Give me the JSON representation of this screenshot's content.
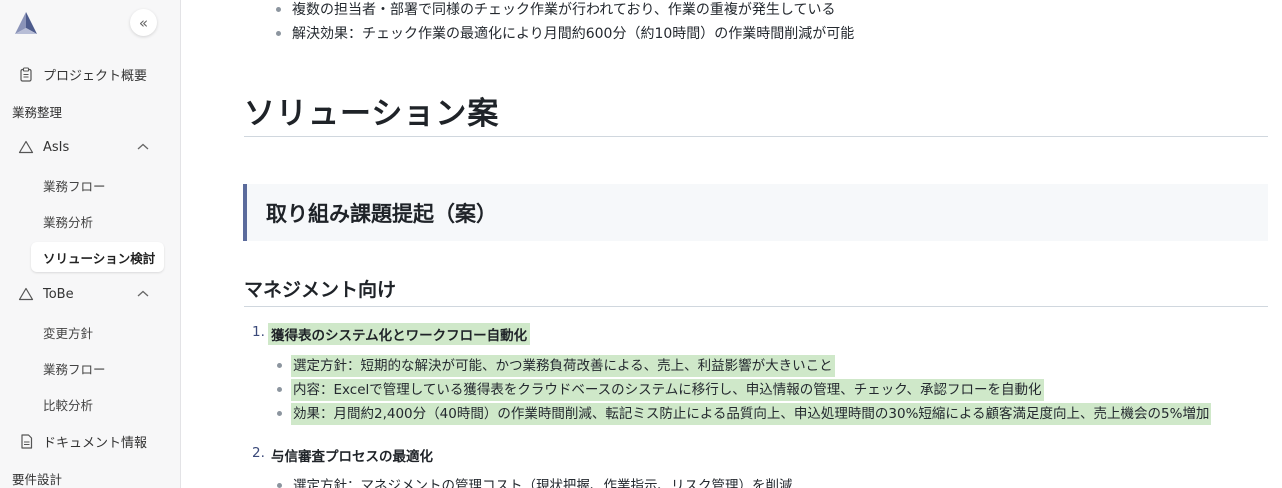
{
  "sidebar": {
    "collapse_glyph": "«",
    "items": [
      {
        "label": "プロジェクト概要",
        "icon": "clipboard-icon"
      },
      {
        "label": "業務整理"
      },
      {
        "label": "AsIs",
        "icon": "triangle-icon"
      },
      {
        "label": "業務フロー"
      },
      {
        "label": "業務分析"
      },
      {
        "label": "ソリューション検討"
      },
      {
        "label": "ToBe",
        "icon": "triangle-icon"
      },
      {
        "label": "変更方針"
      },
      {
        "label": "業務フロー"
      },
      {
        "label": "比較分析"
      },
      {
        "label": "ドキュメント情報",
        "icon": "document-icon"
      },
      {
        "label": "要件設計"
      }
    ]
  },
  "content": {
    "top_bullets": [
      "複数の担当者・部署で同様のチェック作業が行われており、作業の重複が発生している",
      "解決効果：チェック作業の最適化により月間約600分（約10時間）の作業時間削減が可能"
    ],
    "h1": "ソリューション案",
    "callout": "取り組み課題提起（案）",
    "h2": "マネジメント向け",
    "ordered": [
      {
        "num": "1.",
        "title": "獲得表のシステム化とワークフロー自動化",
        "bullets": [
          "選定方針：短期的な解決が可能、かつ業務負荷改善による、売上、利益影響が大きいこと",
          "内容：Excelで管理している獲得表をクラウドベースのシステムに移行し、申込情報の管理、チェック、承認フローを自動化",
          "効果：月間約2,400分（40時間）の作業時間削減、転記ミス防止による品質向上、申込処理時間の30%短縮による顧客満足度向上、売上機会の5%増加"
        ]
      },
      {
        "num": "2.",
        "title": "与信審査プロセスの最適化",
        "bullets": [
          "選定方針：マネジメントの管理コスト（現状把握、作業指示、リスク管理）を削減"
        ]
      }
    ]
  },
  "colors": {
    "highlight": "#cfe8c9",
    "callout_border": "#5b6b9c",
    "sidebar_bg": "#f7f7f8"
  }
}
